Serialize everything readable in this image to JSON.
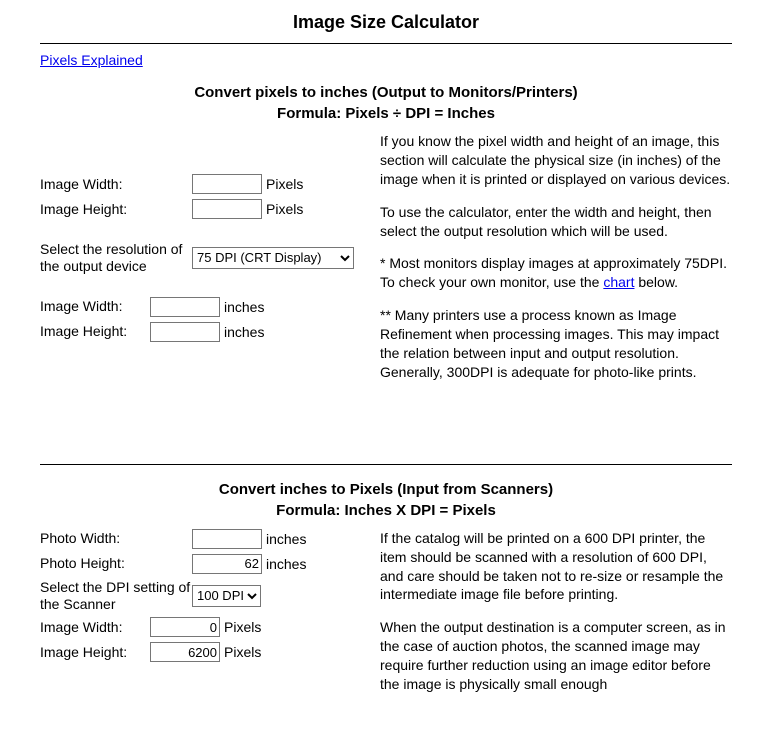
{
  "page": {
    "title": "Image Size Calculator",
    "link_pixels_explained": "Pixels Explained"
  },
  "section1": {
    "heading_line1": "Convert pixels to inches (Output to Monitors/Printers)",
    "heading_line2": "Formula: Pixels ÷ DPI = Inches",
    "labels": {
      "image_width_px": "Image Width:",
      "image_height_px": "Image Height:",
      "select_resolution": "Select the resolution of the output device",
      "image_width_in": "Image Width:",
      "image_height_in": "Image Height:"
    },
    "units": {
      "pixels": "Pixels",
      "inches": "inches"
    },
    "values": {
      "width_px": "",
      "height_px": "",
      "width_in": "",
      "height_in": ""
    },
    "select": {
      "selected": "75 DPI (CRT Display)",
      "options": [
        "75 DPI (CRT Display)"
      ]
    },
    "desc": {
      "p1": "If you know the pixel width and height of an image, this section will calculate the physical size (in inches) of the image when it is printed or displayed on various devices.",
      "p2": "To use the calculator, enter the width and height, then select the output resolution which will be used.",
      "p3_a": "* Most monitors display images at approximately 75DPI. To check your own monitor, use the ",
      "p3_link": "chart",
      "p3_b": " below.",
      "p4": "** Many printers use a process known as Image Refinement when processing images. This may impact the relation between input and output resolution. Generally, 300DPI is adequate for photo-like prints."
    }
  },
  "section2": {
    "heading_line1": "Convert inches to Pixels (Input from Scanners)",
    "heading_line2": "Formula: Inches X DPI = Pixels",
    "labels": {
      "photo_width": "Photo Width:",
      "photo_height": "Photo Height:",
      "select_dpi": "Select the DPI setting of the Scanner",
      "image_width_px": "Image Width:",
      "image_height_px": "Image Height:"
    },
    "units": {
      "inches": "inches",
      "pixels": "Pixels"
    },
    "values": {
      "photo_width": "",
      "photo_height": "62",
      "image_width_px": "0",
      "image_height_px": "6200"
    },
    "select": {
      "selected": "100 DPI",
      "options": [
        "100 DPI"
      ]
    },
    "desc": {
      "p1": "If the catalog will be printed on a 600 DPI printer, the item should be scanned with a resolution of 600 DPI, and care should be taken not to re-size or resample the intermediate image file before printing.",
      "p2": "When the output destination is a computer screen, as in the case of auction photos, the scanned image may require further reduction using an image editor before the image is physically small enough"
    }
  }
}
